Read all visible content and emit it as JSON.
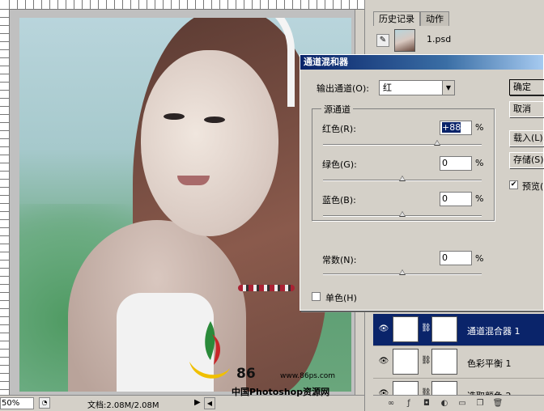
{
  "document": {
    "zoom": "50%",
    "doc_size": "文档:2.08M/2.08M",
    "watermark": {
      "brand": "86",
      "url": "www.86ps.com",
      "site": "中国Photoshop资源网"
    }
  },
  "history_panel": {
    "tabs": [
      "历史记录",
      "动作"
    ],
    "snapshot_name": "1.psd"
  },
  "layers_panel": {
    "layers": [
      {
        "name": "通道混合器 1",
        "selected": true
      },
      {
        "name": "色彩平衡 1",
        "selected": false
      },
      {
        "name": "选取颜色 2",
        "selected": false
      }
    ]
  },
  "dialog": {
    "title": "通道混和器",
    "output_channel_label": "输出通道(O):",
    "output_channel_value": "红",
    "source_group_label": "源通道",
    "channels": [
      {
        "label": "红色(R):",
        "value": "+88",
        "unit": "%",
        "slider": 88
      },
      {
        "label": "绿色(G):",
        "value": "0",
        "unit": "%",
        "slider": 0
      },
      {
        "label": "蓝色(B):",
        "value": "0",
        "unit": "%",
        "slider": 0
      }
    ],
    "constant": {
      "label": "常数(N):",
      "value": "0",
      "unit": "%",
      "slider": 0
    },
    "monochrome_label": "单色(H)",
    "buttons": {
      "ok": "确定",
      "cancel": "取消",
      "load": "载入(L)...",
      "save": "存储(S)..."
    },
    "preview_label": "预览(P)",
    "preview_checked": true
  }
}
